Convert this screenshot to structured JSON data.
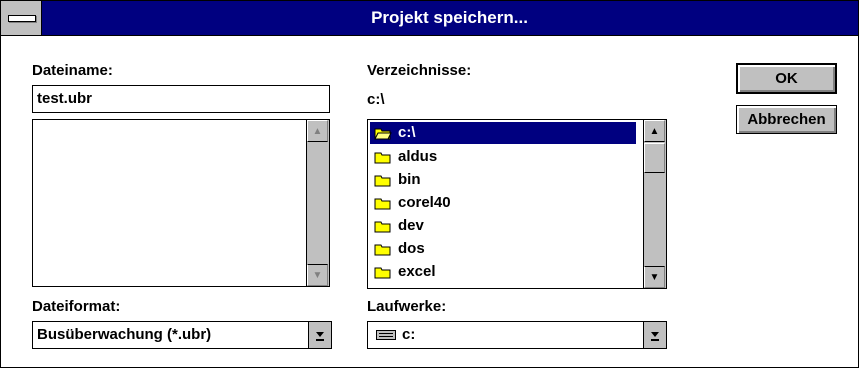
{
  "window": {
    "title": "Projekt speichern..."
  },
  "filename": {
    "label": "Dateiname:",
    "value": "test.ubr",
    "files": []
  },
  "directories": {
    "label": "Verzeichnisse:",
    "current_path": "c:\\",
    "items": [
      {
        "name": "c:\\",
        "icon": "open-folder-icon",
        "selected": true
      },
      {
        "name": "aldus",
        "icon": "folder-icon",
        "selected": false
      },
      {
        "name": "bin",
        "icon": "folder-icon",
        "selected": false
      },
      {
        "name": "corel40",
        "icon": "folder-icon",
        "selected": false
      },
      {
        "name": "dev",
        "icon": "folder-icon",
        "selected": false
      },
      {
        "name": "dos",
        "icon": "folder-icon",
        "selected": false
      },
      {
        "name": "excel",
        "icon": "folder-icon",
        "selected": false
      }
    ]
  },
  "fileformat": {
    "label": "Dateiformat:",
    "value": "Busüberwachung (*.ubr)"
  },
  "drives": {
    "label": "Laufwerke:",
    "value": "c:",
    "icon": "drive-icon"
  },
  "buttons": {
    "ok": "OK",
    "cancel": "Abbrechen"
  },
  "colors": {
    "titlebar": "#000080",
    "face": "#c0c0c0",
    "folder": "#ffff00"
  }
}
